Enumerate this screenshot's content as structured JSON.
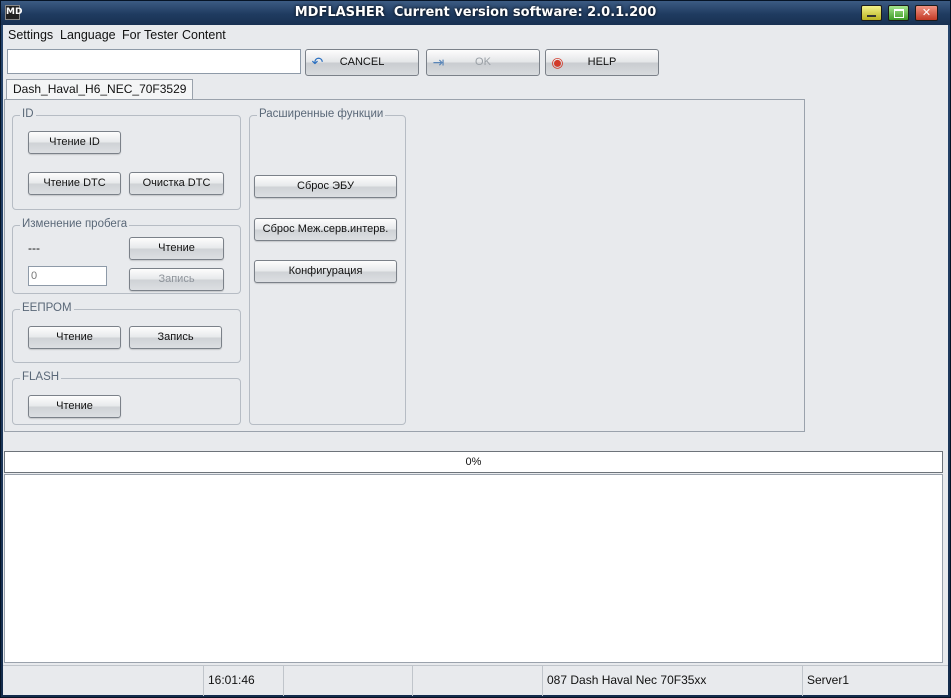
{
  "window": {
    "title": "MDFLASHER  Current version software: 2.0.1.200",
    "icon_text": "MD"
  },
  "menu": [
    "Settings",
    "Language",
    "For Tester",
    "Content"
  ],
  "toolbar": {
    "input_value": "",
    "cancel_label": "CANCEL",
    "ok_label": "OK",
    "help_label": "HELP"
  },
  "tab": {
    "label": "Dash_Haval_H6_NEC_70F3529"
  },
  "groups": {
    "id": {
      "label": "ID",
      "read_id": "Чтение ID",
      "read_dtc": "Чтение DTC",
      "clear_dtc": "Очистка DTC"
    },
    "mileage": {
      "label": "Изменение пробега",
      "value": "---",
      "read": "Чтение",
      "input_value": "0",
      "write": "Запись"
    },
    "eeprom": {
      "label": "EEПРОМ",
      "read": "Чтение",
      "write": "Запись"
    },
    "flash": {
      "label": "FLASH",
      "read": "Чтение"
    },
    "advanced": {
      "label": "Расширенные функции",
      "reset_ecu": "Сброс ЭБУ",
      "reset_service": "Сброс Меж.серв.интерв.",
      "configuration": "Конфигурация"
    }
  },
  "progress": {
    "text": "0%",
    "value": 0
  },
  "status": {
    "time": "16:01:46",
    "device": "087 Dash Haval Nec 70F35xx",
    "server": "Server1"
  }
}
